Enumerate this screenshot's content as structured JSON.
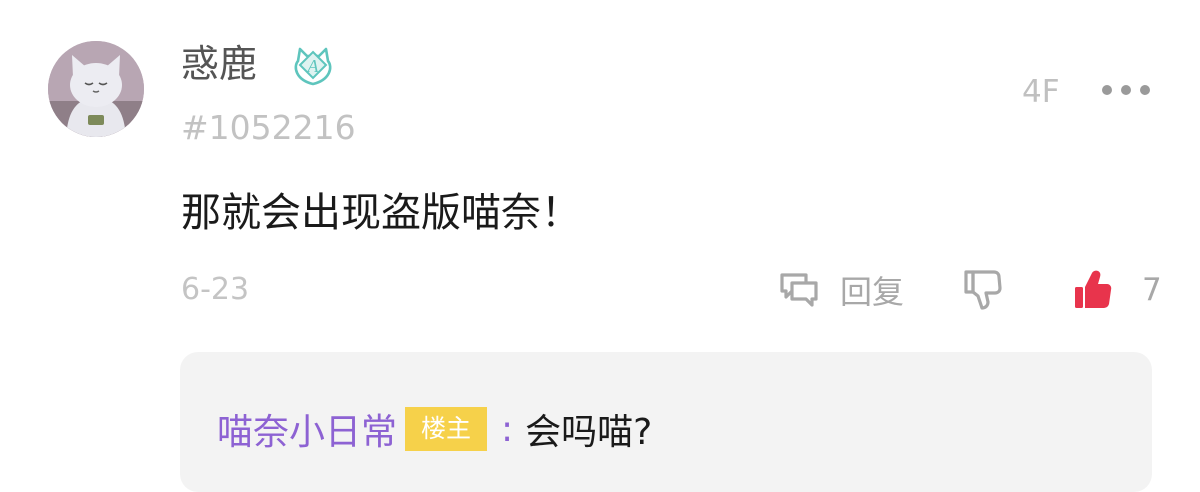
{
  "comment": {
    "username": "惑鹿",
    "user_id": "#1052216",
    "floor": "4F",
    "content": "那就会出现盗版喵奈！",
    "date": "6-23",
    "reply_label": "回复",
    "like_count": "7",
    "badge_letter": "A"
  },
  "sub_reply": {
    "author": "喵奈小日常",
    "op_tag": "楼主",
    "colon": ":",
    "text": "会吗喵?"
  },
  "colors": {
    "like_active": "#e8344c",
    "author_purple": "#8d62d3",
    "op_tag_bg": "#f6d14a",
    "badge_teal": "#5ec5bd"
  },
  "icons": {
    "more": "more-horizontal-icon",
    "reply": "comment-bubble-icon",
    "dislike": "thumbs-down-icon",
    "like": "thumbs-up-icon"
  }
}
